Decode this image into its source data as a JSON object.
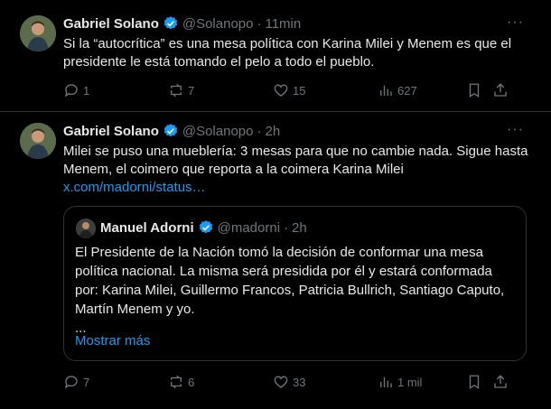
{
  "tweets": [
    {
      "author": {
        "name": "Gabriel Solano",
        "handle": "@Solanopo"
      },
      "time": "11min",
      "text": "Si la “autocrítica” es una mesa política con Karina Milei y Menem es que el presidente le está tomando el pelo a todo el pueblo.",
      "stats": {
        "replies": "1",
        "reposts": "7",
        "likes": "15",
        "views": "627"
      }
    },
    {
      "author": {
        "name": "Gabriel Solano",
        "handle": "@Solanopo"
      },
      "time": "2h",
      "text": "Milei se puso una mueblería: 3 mesas para que no cambie nada. Sigue hasta Menem, el coimero que reporta a la coimera Karina Milei",
      "link": "x.com/madorni/status…",
      "quote": {
        "author": {
          "name": "Manuel Adorni",
          "handle": "@madorni"
        },
        "time": "2h",
        "text": "El Presidente de la Nación tomó la decisión de conformar una mesa política nacional. La misma será presidida por él y estará conformada por: Karina Milei, Guillermo Francos, Patricia Bullrich, Santiago Caputo, Martín Menem y yo.",
        "ellipsis": "...",
        "show_more": "Mostrar más"
      },
      "stats": {
        "replies": "7",
        "reposts": "6",
        "likes": "33",
        "views": "1 mil"
      }
    }
  ],
  "ui": {
    "dot": "·",
    "more": "···"
  },
  "colors": {
    "background": "#000000",
    "text": "#e7e9ea",
    "muted": "#71767b",
    "accent": "#1d9bf0",
    "border": "#2f3336"
  }
}
